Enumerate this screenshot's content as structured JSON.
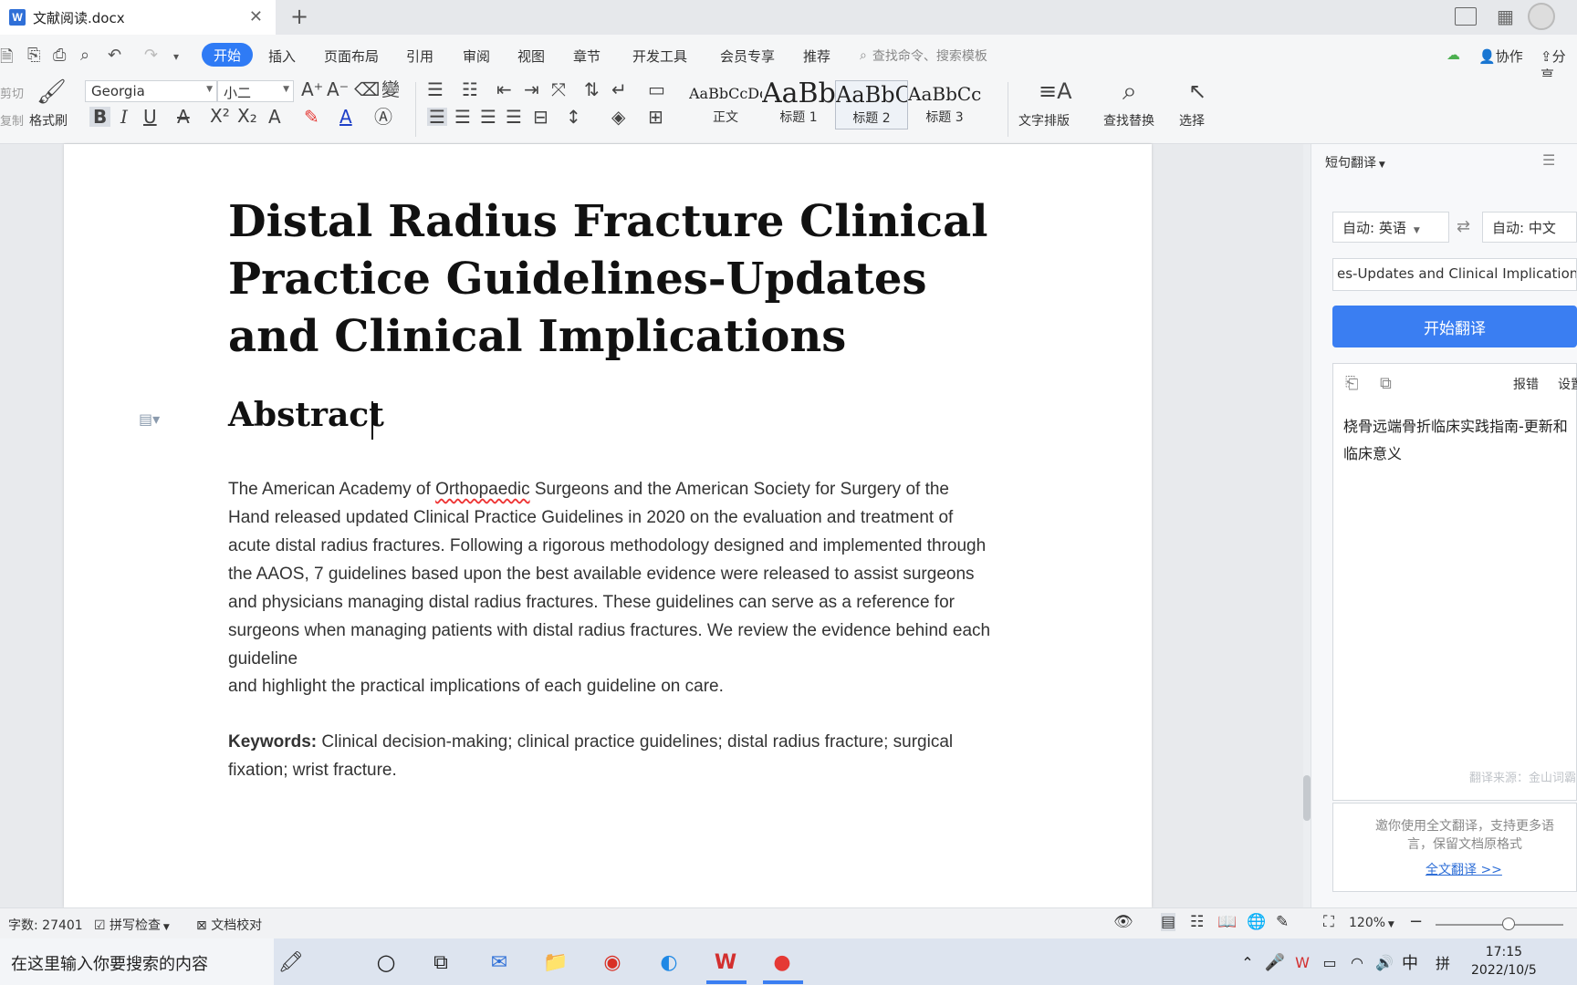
{
  "window": {
    "doc_tab_title": "文献阅读.docx",
    "new_tab": "+"
  },
  "menu": {
    "items": [
      "开始",
      "插入",
      "页面布局",
      "引用",
      "审阅",
      "视图",
      "章节",
      "开发工具",
      "会员专享",
      "推荐"
    ],
    "search_placeholder": "查找命令、搜索模板",
    "collab": "协作",
    "share": "分享"
  },
  "ribbon": {
    "cut": "剪切",
    "copy": "复制",
    "format_painter": "格式刷",
    "font_name": "Georgia",
    "font_size": "小二",
    "styles": [
      {
        "preview": "AaBbCcDd",
        "label": "正文"
      },
      {
        "preview": "AaBb",
        "label": "标题 1"
      },
      {
        "preview": "AaBbC",
        "label": "标题 2"
      },
      {
        "preview": "AaBbCcI",
        "label": "标题 3"
      }
    ],
    "text_layout": "文字排版",
    "find_replace": "查找替换",
    "select": "选择"
  },
  "document": {
    "title": "Distal Radius Fracture Clinical Practice Guidelines-Updates and Clinical Implications",
    "heading": "Abstract",
    "abstract_prefix": "The American Academy of ",
    "abstract_misspelled": "Orthopaedic",
    "abstract_rest": " Surgeons and the American Society for Surgery of the Hand released updated Clinical Practice Guidelines in 2020 on the evaluation and treatment of acute distal radius fractures. Following a rigorous methodology designed and implemented through the AAOS, 7 guidelines based upon the best available evidence were released to assist surgeons and physicians managing distal radius fractures. These guidelines can serve as a reference for surgeons when managing patients with distal radius fractures. We review the evidence behind each guideline",
    "abstract_cont": "and highlight the practical implications of each guideline on care.",
    "keywords_label": "Keywords:",
    "keywords_text": " Clinical decision-making; clinical practice guidelines; distal radius fracture; surgical fixation; wrist fracture."
  },
  "translate_panel": {
    "title": "短句翻译",
    "source_lang": "自动: 英语",
    "target_lang": "自动: 中文",
    "input_text": "es-Updates and Clinical Implications",
    "button": "开始翻译",
    "report": "报错",
    "settings": "设置",
    "result_line1": "桡骨远端骨折临床实践指南-更新和",
    "result_line2": "临床意义",
    "source_credit": "翻译来源：金山词霸",
    "invite_text": "邀你使用全文翻译，支持更多语言，保留文档原格式",
    "invite_link": "全文翻译 >>"
  },
  "statusbar": {
    "word_count": "字数: 27401",
    "spell_check": "拼写检查",
    "doc_proof": "文档校对",
    "zoom": "120%",
    "zoom_fraction": 0.57
  },
  "taskbar": {
    "search_placeholder": "在这里输入你要搜索的内容",
    "ime_mode": "中",
    "ime_pinyin": "拼",
    "time": "17:15",
    "date": "2022/10/5"
  }
}
